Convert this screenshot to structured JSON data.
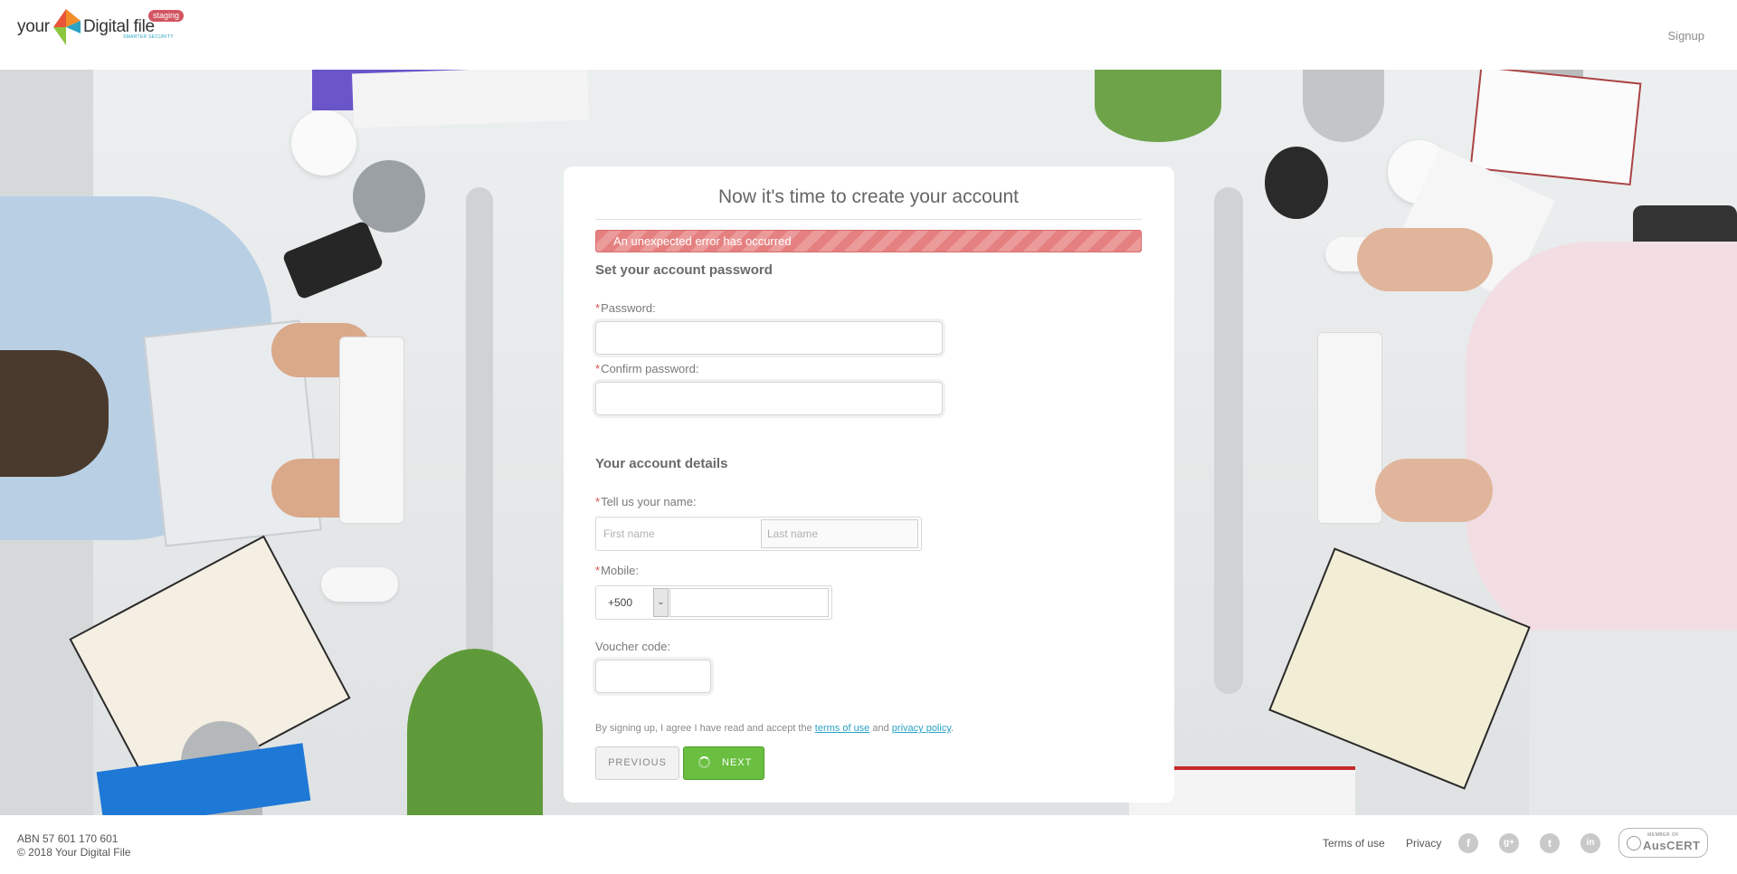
{
  "header": {
    "logo_your": "your",
    "logo_digital_file": "Digital file",
    "logo_tagline": "SMARTER SECURITY",
    "env_badge": "staging",
    "signup_label": "Signup"
  },
  "form": {
    "title": "Now it's time to create your account",
    "error_message": "An unexpected error has occurred",
    "password_section": "Set your account password",
    "password_label": "Password:",
    "confirm_password_label": "Confirm password:",
    "details_section": "Your account details",
    "name_label": "Tell us your name:",
    "first_name_placeholder": "First name",
    "last_name_placeholder": "Last name",
    "mobile_label": "Mobile:",
    "mobile_country_code": "+500",
    "voucher_label": "Voucher code:",
    "terms_prefix": "By signing up, I agree I have read and accept the",
    "terms_link": "terms of use",
    "terms_and": "and",
    "privacy_link": "privacy policy",
    "terms_suffix": ".",
    "required_marker": "*",
    "previous_label": "PREVIOUS",
    "next_label": "NEXT"
  },
  "footer": {
    "abn": "ABN 57 601 170 601",
    "copyright": "© 2018 Your Digital File",
    "terms_link": "Terms of use",
    "privacy_link": "Privacy",
    "social": [
      "facebook-icon",
      "google-plus-icon",
      "twitter-icon",
      "linkedin-icon"
    ],
    "auscert_top": "MEMBER OF",
    "auscert_name": "AusCERT"
  },
  "colors": {
    "accent": "#2aa3c4",
    "error": "#e58080",
    "success_button": "#6abf40",
    "badge": "#d25561"
  }
}
